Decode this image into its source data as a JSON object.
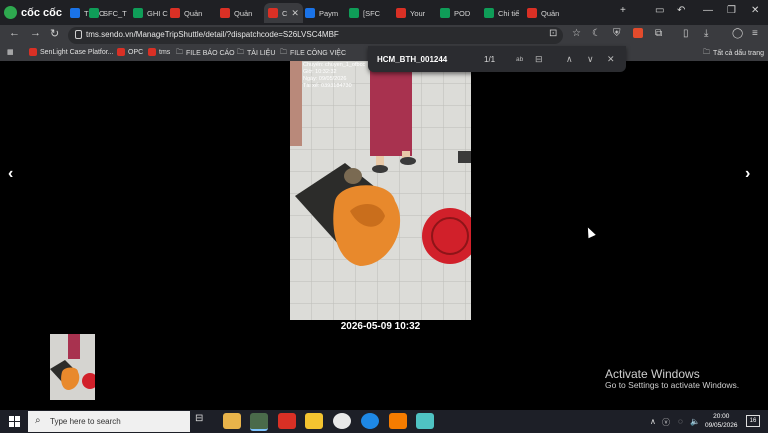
{
  "browser": {
    "brand": "cốc cốc",
    "tabs": [
      {
        "label": "THEO",
        "color": "#1a73e8"
      },
      {
        "label": "SFC_T",
        "color": "#0f9d58"
      },
      {
        "label": "GHI C",
        "color": "#0f9d58"
      },
      {
        "label": "Quản",
        "color": "#d93025"
      },
      {
        "label": "Quản",
        "color": "#d93025"
      },
      {
        "label": "C",
        "color": "#d93025",
        "active": true
      },
      {
        "label": "Paym",
        "color": "#1a73e8"
      },
      {
        "label": "[SFC",
        "color": "#0f9d58"
      },
      {
        "label": "Your",
        "color": "#d93025"
      },
      {
        "label": "POD",
        "color": "#0f9d58"
      },
      {
        "label": "Chi tiế",
        "color": "#0f9d58"
      },
      {
        "label": "Quản",
        "color": "#d93025"
      }
    ],
    "new_tab": "+",
    "url": "tms.sendo.vn/ManageTripShuttle/detail/?dispatchcode=S26LVSC4MBF",
    "bookmarks": [
      "SenLight Case Platfor...",
      "OPC",
      "tms",
      "FILE BÁO CÁO",
      "TÀI LIỆU",
      "FILE CÔNG VIỆC"
    ],
    "all_bookmarks": "Tất cả dấu trang"
  },
  "find": {
    "query": "HCM_BTH_001244",
    "count": "1/1",
    "match_case": "ab"
  },
  "photo": {
    "overlay_lines": [
      "Chuyến: chuyen_1_ofbcc",
      "Giờ: 10:32:32",
      "Ngày: 09/05/2026",
      "Tài xế: 0393184730"
    ],
    "caption": "2026-05-09 10:32"
  },
  "nav": {
    "prev": "‹",
    "next": "›"
  },
  "watermark": {
    "title": "Activate Windows",
    "subtitle": "Go to Settings to activate Windows."
  },
  "taskbar": {
    "search_placeholder": "Type here to search",
    "time": "20:00",
    "date": "09/05/2026",
    "notifications": "16"
  }
}
